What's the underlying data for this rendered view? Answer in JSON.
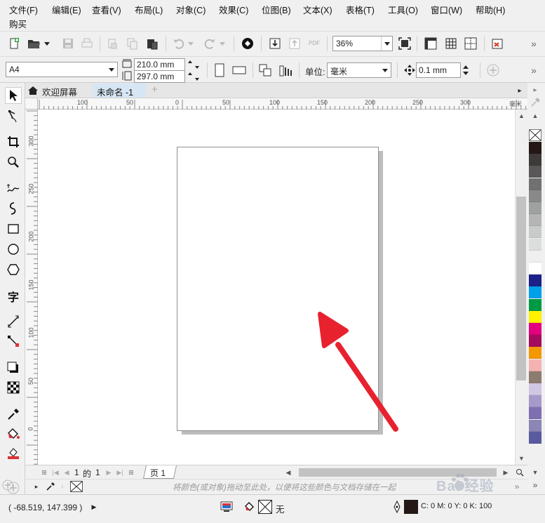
{
  "menu": {
    "items": [
      "文件(F)",
      "编辑(E)",
      "查看(V)",
      "布局(L)",
      "对象(C)",
      "效果(C)",
      "位图(B)",
      "文本(X)",
      "表格(T)",
      "工具(O)",
      "窗口(W)",
      "帮助(H)",
      "购买"
    ]
  },
  "toolbar": {
    "zoom_value": "36%",
    "pdf_label": "PDF",
    "icons": [
      "new-document-icon",
      "open-folder-icon",
      "save-icon",
      "print-icon",
      "cut-icon",
      "copy-icon",
      "paste-icon",
      "undo-icon",
      "redo-icon",
      "corel-connect-icon",
      "import-icon",
      "export-icon",
      "publish-pdf-icon",
      "full-screen-icon",
      "rulers-icon",
      "grid-icon",
      "guidelines-icon",
      "snap-off-icon",
      "overflow-icon"
    ]
  },
  "propertybar": {
    "page_size": "A4",
    "width": "210.0 mm",
    "height": "297.0 mm",
    "unit_label": "单位:",
    "unit_value": "毫米",
    "nudge_value": "0.1 mm"
  },
  "tabs": {
    "welcome": "欢迎屏幕",
    "document": "未命名 -1",
    "add": "+"
  },
  "ruler": {
    "h_ticks": [
      "100",
      "50",
      "0",
      "50",
      "100",
      "150",
      "200",
      "250",
      "300"
    ],
    "h_unit": "毫米",
    "v_ticks": [
      "300",
      "250",
      "200",
      "150",
      "100",
      "50",
      "0"
    ]
  },
  "page_nav": {
    "current": "1",
    "of_label": "的",
    "total": "1",
    "page_tab": "页 1"
  },
  "document_palette": {
    "hint": "将颜色(或对象)拖动至此处，以便将这些颜色与文档存储在一起"
  },
  "palette": {
    "colors": [
      "#231815",
      "#3e3a39",
      "#595757",
      "#727171",
      "#898989",
      "#9fa0a0",
      "#b5b5b6",
      "#c9caca",
      "#dcdddd",
      "#efefef",
      "#ffffff",
      "#1d2088",
      "#00a0e9",
      "#009944",
      "#fff100",
      "#e4007f",
      "#a40b5d",
      "#f39800",
      "#f5b2b2",
      "#8c7b6f",
      "#d1c7e3",
      "#a59aca",
      "#7e6fb0",
      "#8c86b6",
      "#5a5a9e"
    ]
  },
  "status": {
    "coords": "( -68.519, 147.399 )",
    "fill_label": "无",
    "outline_label": "C: 0 M: 0 Y: 0 K: 100"
  },
  "watermark": {
    "text": "Bai 经验"
  },
  "colors": {
    "annotation_arrow": "#e8212f"
  }
}
